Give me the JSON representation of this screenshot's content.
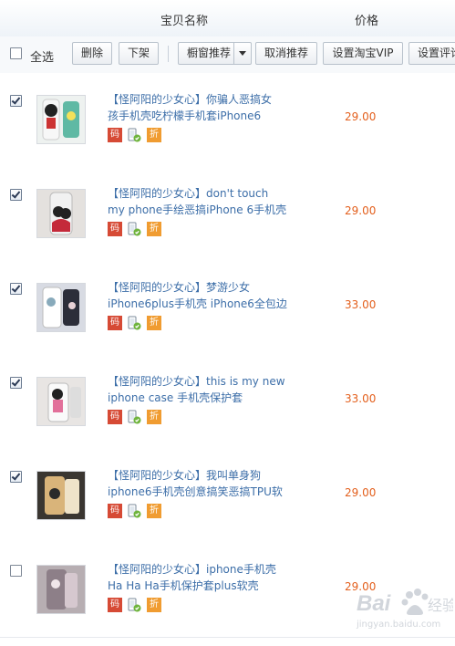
{
  "header": {
    "col_name": "宝贝名称",
    "col_price": "价格"
  },
  "toolbar": {
    "select_all": "全选",
    "select_all_checked": false,
    "buttons": [
      "删除",
      "下架",
      "橱窗推荐",
      "取消推荐",
      "设置淘宝VIP",
      "设置评论"
    ]
  },
  "rows": [
    {
      "checked": true,
      "title_line1": "【怪阿阳的少女心】你骗人恶搞女",
      "title_line2": "孩手机壳吃柠檬手机套iPhone6",
      "price": "29.00",
      "tags": [
        "码",
        "phone",
        "折"
      ]
    },
    {
      "checked": true,
      "title_line1": "【怪阿阳的少女心】don't touch",
      "title_line2": "my phone手绘恶搞iPhone 6手机壳",
      "price": "29.00",
      "tags": [
        "码",
        "phone",
        "折"
      ]
    },
    {
      "checked": true,
      "title_line1": "【怪阿阳的少女心】梦游少女",
      "title_line2": "iPhone6plus手机壳 iPhone6全包边",
      "price": "33.00",
      "tags": [
        "码",
        "phone",
        "折"
      ]
    },
    {
      "checked": true,
      "title_line1": "【怪阿阳的少女心】this is my new",
      "title_line2": "iphone case 手机壳保护套",
      "price": "33.00",
      "tags": [
        "码",
        "phone",
        "折"
      ]
    },
    {
      "checked": true,
      "title_line1": "【怪阿阳的少女心】我叫单身狗",
      "title_line2": "iphone6手机壳创意搞笑恶搞TPU软",
      "price": "29.00",
      "tags": [
        "码",
        "phone",
        "折"
      ]
    },
    {
      "checked": false,
      "title_line1": "【怪阿阳的少女心】iphone手机壳",
      "title_line2": "Ha Ha Ha手机保护套plus软壳",
      "price": "29.00",
      "tags": [
        "码",
        "phone",
        "折"
      ]
    }
  ],
  "watermark": {
    "text": "Baidu 经验",
    "url": "jingyan.baidu.com"
  }
}
